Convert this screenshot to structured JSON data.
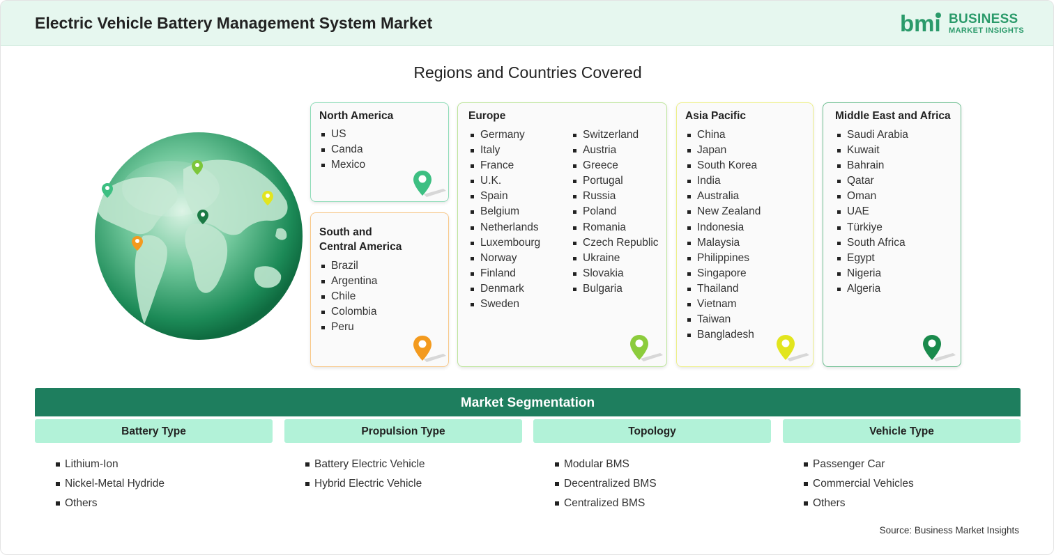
{
  "header": {
    "title": "Electric Vehicle Battery Management System Market",
    "logo_mark": "bmi",
    "logo_line1": "BUSINESS",
    "logo_line2": "MARKET INSIGHTS"
  },
  "regions_title": "Regions and Countries Covered",
  "regions": {
    "north_america": {
      "title": "North America",
      "countries": [
        "US",
        "Canda",
        "Mexico"
      ],
      "color": "#3dbf82"
    },
    "south_central_america": {
      "title_line1": "South and",
      "title_line2": "Central America",
      "countries": [
        "Brazil",
        "Argentina",
        "Chile",
        "Colombia",
        "Peru"
      ],
      "color": "#f39a1e"
    },
    "europe": {
      "title": "Europe",
      "countries_col1": [
        "Germany",
        "Italy",
        "France",
        "U.K.",
        "Spain",
        "Belgium",
        "Netherlands",
        "Luxembourg",
        "Norway",
        "Finland",
        "Denmark",
        "Sweden"
      ],
      "countries_col2": [
        "Switzerland",
        "Austria",
        "Greece",
        "Portugal",
        "Russia",
        "Poland",
        "Romania",
        "Czech Republic",
        "Ukraine",
        "Slovakia",
        "Bulgaria"
      ],
      "color": "#8ccc3c"
    },
    "asia_pacific": {
      "title": "Asia Pacific",
      "countries": [
        "China",
        "Japan",
        "South Korea",
        "India",
        "Australia",
        "New Zealand",
        "Indonesia",
        "Malaysia",
        "Philippines",
        "Singapore",
        "Thailand",
        "Vietnam",
        "Taiwan",
        "Bangladesh"
      ],
      "color": "#e2e51e"
    },
    "middle_east_africa": {
      "title": "Middle East and Africa",
      "countries": [
        "Saudi Arabia",
        "Kuwait",
        "Bahrain",
        "Qatar",
        "Oman",
        "UAE",
        "Türkiye",
        "South Africa",
        "Egypt",
        "Nigeria",
        "Algeria"
      ],
      "color": "#1a8a4c"
    }
  },
  "segmentation": {
    "title": "Market Segmentation",
    "columns": [
      {
        "heading": "Battery Type",
        "items": [
          "Lithium-Ion",
          "Nickel-Metal Hydride",
          "Others"
        ]
      },
      {
        "heading": "Propulsion Type",
        "items": [
          "Battery Electric Vehicle",
          "Hybrid Electric Vehicle"
        ]
      },
      {
        "heading": "Topology",
        "items": [
          "Modular BMS",
          "Decentralized BMS",
          "Centralized BMS"
        ]
      },
      {
        "heading": "Vehicle Type",
        "items": [
          "Passenger Car",
          "Commercial Vehicles",
          "Others"
        ]
      }
    ]
  },
  "source": "Source: Business Market Insights",
  "icons": {
    "globe": "globe-icon",
    "pin": "map-pin-icon",
    "logo": "bmi-logo-icon"
  }
}
